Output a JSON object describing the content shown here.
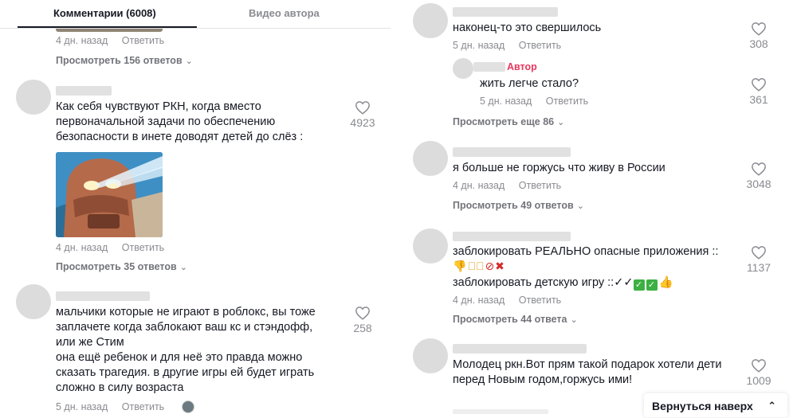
{
  "tabs": {
    "comments": "Комментарии (6008)",
    "author_videos": "Видео автора"
  },
  "reply_label": "Ответить",
  "left": {
    "top_meta_date": "4 дн. назад",
    "top_view": "Просмотреть 156 ответов",
    "c1": {
      "text_lines": [
        "Как себя чувствуют РКН, когда вместо",
        "первоначальной задачи по обеспечению",
        "безопасности в инете доводят детей до слёз :"
      ],
      "likes": "4923",
      "date": "4 дн. назад",
      "view": "Просмотреть 35 ответов"
    },
    "c2": {
      "text_lines": [
        "мальчики которые не играют в роблокс, вы тоже",
        "заплачете когда заблокают ваш кс и стэндофф,",
        "или же Стим",
        "она ещё ребенок и для неё это правда можно",
        "сказать трагедия. в другие игры ей будет играть",
        "сложно в силу возраста"
      ],
      "likes": "258",
      "date": "5 дн. назад"
    }
  },
  "right": {
    "c1": {
      "text": "наконец-то это свершилось",
      "likes": "308",
      "date": "5 дн. назад"
    },
    "reply1": {
      "author_tag": "Автор",
      "text": "жить легче стало?",
      "likes": "361",
      "date": "5 дн. назад",
      "view": "Просмотреть еще 86"
    },
    "c2": {
      "text": "я больше не горжусь что живу в России",
      "likes": "3048",
      "date": "4 дн. назад",
      "view": "Просмотреть 49 ответов"
    },
    "c3": {
      "text1": "заблокировать РЕАЛЬНО опасные приложения ::",
      "text2": "заблокировать детскую игру ::✓✓",
      "likes": "1137",
      "date": "4 дн. назад",
      "view": "Просмотреть 44 ответа"
    },
    "c4": {
      "text_lines": [
        "Молодец ркн.Вот прям такой подарок хотели дети",
        "перед Новым годом,горжусь ими!"
      ],
      "likes": "1009"
    },
    "back_to_top": "Вернуться наверх"
  },
  "icons": {
    "heart": "heart-outline-icon",
    "chevron": "chevron-down-icon",
    "arrow_up": "double-chevron-up-icon"
  },
  "colors": {
    "author_tag": "#e8385f",
    "muted": "#8a8b91"
  }
}
